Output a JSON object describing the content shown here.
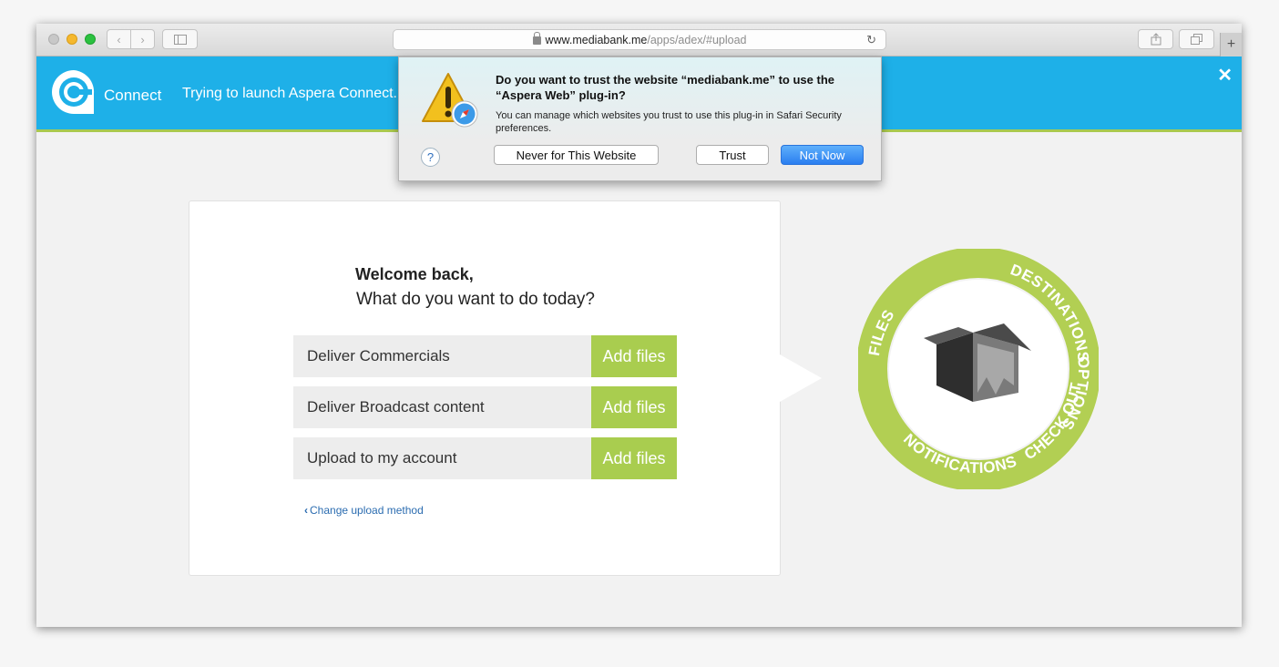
{
  "browser": {
    "url_host": "www.mediabank.me",
    "url_path": "/apps/adex/#upload",
    "back_icon": "chevron-left-icon",
    "forward_icon": "chevron-right-icon",
    "sidebar_icon": "sidebar-icon",
    "share_icon": "share-icon",
    "tabs_icon": "tabs-icon",
    "reload_glyph": "↻",
    "new_tab_glyph": "+"
  },
  "header": {
    "brand": "Connect",
    "status": "Trying to launch Aspera Connect.",
    "close_glyph": "✕",
    "bg_color": "#1eb0e8",
    "accent_color": "#a9c94f"
  },
  "dialog": {
    "title": "Do you want to trust the website “mediabank.me” to use the “Aspera Web” plug-in?",
    "message": "You can manage which websites you trust to use this plug-in in Safari Security preferences.",
    "help_glyph": "?",
    "never_label": "Never for This Website",
    "trust_label": "Trust",
    "not_now_label": "Not Now",
    "icon": "warning-safari-icon"
  },
  "upload": {
    "welcome": "Welcome back,",
    "question": "What do you want to do today?",
    "rows": [
      {
        "label": "Deliver Commercials",
        "button": "Add files"
      },
      {
        "label": "Deliver Broadcast content",
        "button": "Add files"
      },
      {
        "label": "Upload to my account",
        "button": "Add files"
      }
    ],
    "change_chevron": "‹",
    "change_link": "Change upload method"
  },
  "wheel": {
    "labels": [
      "DESTINATIONS",
      "OPTIONS",
      "NOTIFICATIONS",
      "CHECK OUT",
      "FILES"
    ],
    "color": "#b2cf53"
  }
}
